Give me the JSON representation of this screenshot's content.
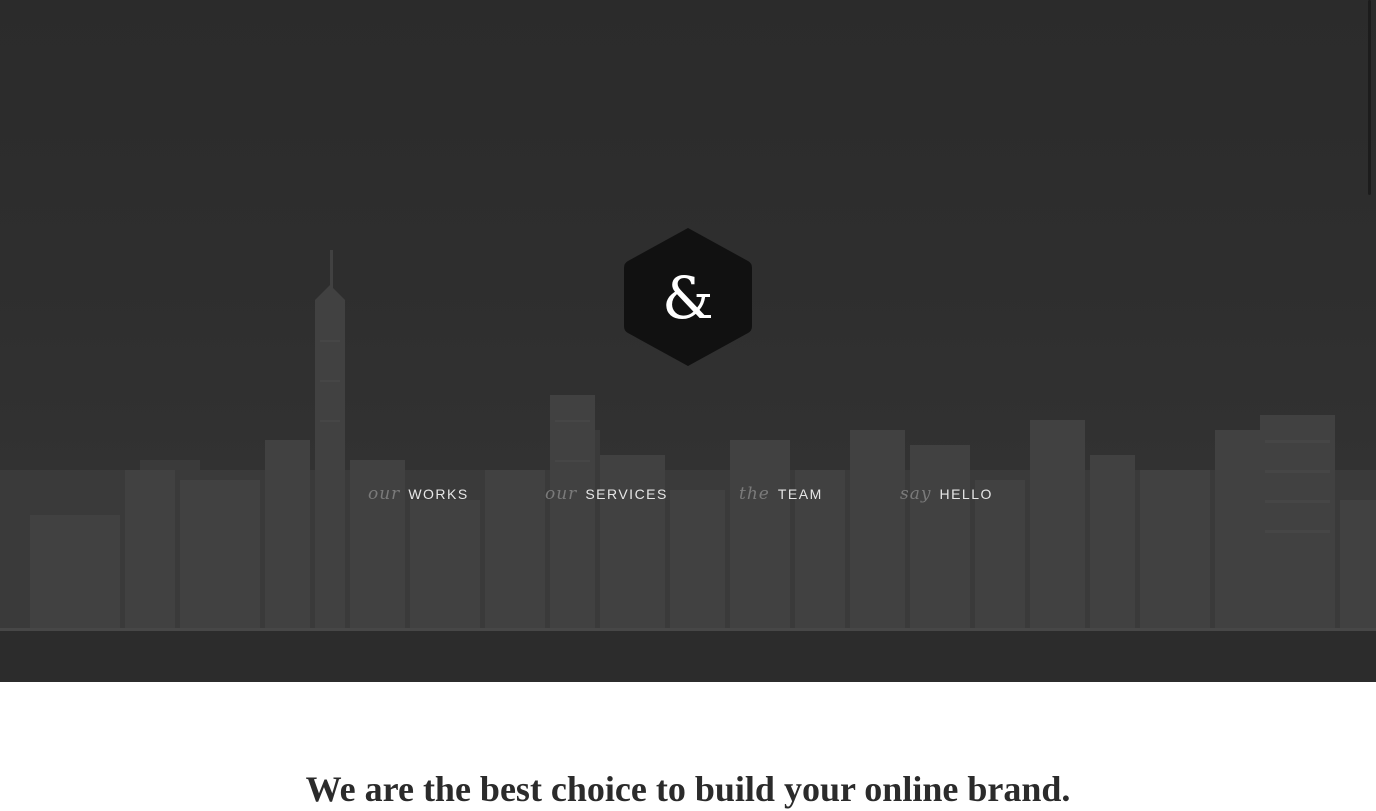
{
  "hero": {
    "logo_glyph": "&",
    "nav": [
      {
        "prefix": "our",
        "label": "WORKS"
      },
      {
        "prefix": "our",
        "label": "SERVICES"
      },
      {
        "prefix": "the",
        "label": "TEAM"
      },
      {
        "prefix": "say",
        "label": "HELLO"
      }
    ]
  },
  "intro": {
    "tagline": "We are the best choice to build your online brand."
  },
  "colors": {
    "hero_overlay": "#2e2e2e",
    "logo_fill": "#111111",
    "nav_prefix": "#7a7a7a",
    "nav_label": "#e6e6e6",
    "tagline": "#2b2b2b"
  }
}
